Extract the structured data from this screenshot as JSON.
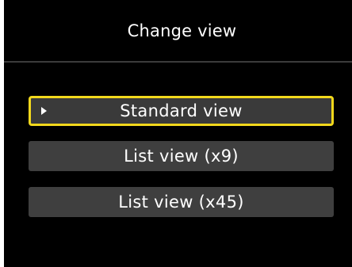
{
  "title": "Change view",
  "menu": {
    "items": [
      {
        "label": "Standard view",
        "selected": true
      },
      {
        "label": "List view (x9)",
        "selected": false
      },
      {
        "label": "List view (x45)",
        "selected": false
      }
    ]
  },
  "colors": {
    "background": "#000000",
    "item_background": "#3f3f3f",
    "selection_border": "#f2d81c",
    "text": "#ffffff"
  },
  "icons": {
    "selection_indicator": "triangle-right-icon"
  }
}
